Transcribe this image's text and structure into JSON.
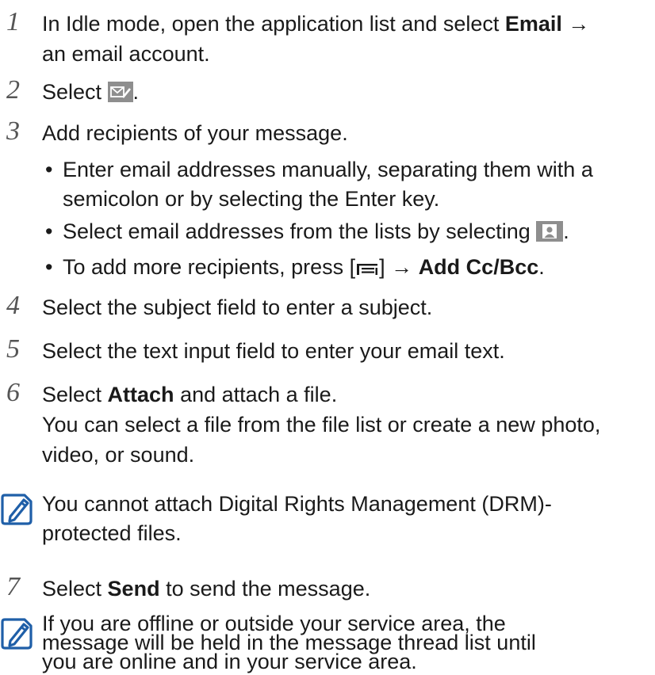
{
  "steps": {
    "s1": {
      "num": "1",
      "text": "In Idle mode, open the application list and select ",
      "bold": "Email",
      "arrow": " →",
      "cont": "an email account."
    },
    "s2": {
      "num": "2",
      "text": "Select ",
      "end": "."
    },
    "s3": {
      "num": "3",
      "text": "Add recipients of your message.",
      "bullets": {
        "b1a": "Enter email addresses manually, separating them with a",
        "b1b": "semicolon or by selecting the Enter key.",
        "b2": "Select email addresses from the lists by selecting ",
        "b2end": ".",
        "b3a": "To add more recipients, press [",
        "b3b": "] → ",
        "b3bold": "Add Cc/Bcc",
        "b3end": "."
      }
    },
    "s4": {
      "num": "4",
      "text": "Select the subject field to enter a subject."
    },
    "s5": {
      "num": "5",
      "text": "Select the text input field to enter your email text."
    },
    "s6": {
      "num": "6",
      "pre": "Select ",
      "bold": "Attach",
      "post": " and attach a file.",
      "line2": "You can select a file from the file list or create a new photo,",
      "line3": "video, or sound."
    },
    "s7": {
      "num": "7",
      "pre": "Select ",
      "bold": "Send",
      "post": " to send the message."
    }
  },
  "notes": {
    "n1": {
      "line1": "You cannot attach Digital Rights Management (DRM)-",
      "line2": "protected files."
    },
    "n2": {
      "line1": "If you are offline or outside your service area, the",
      "line2": "message will be held in the message thread list until",
      "line3": "you are online and in your service area."
    }
  },
  "bullet_char": "•",
  "icons": {
    "compose": "compose-email-icon",
    "contacts": "contacts-icon",
    "menu": "menu-key-icon",
    "note": "note-pencil-icon"
  },
  "colors": {
    "text": "#1a1a1a",
    "step_number": "#555555",
    "icon_blue": "#1f5fa8",
    "icon_gray": "#8e8e8e"
  }
}
